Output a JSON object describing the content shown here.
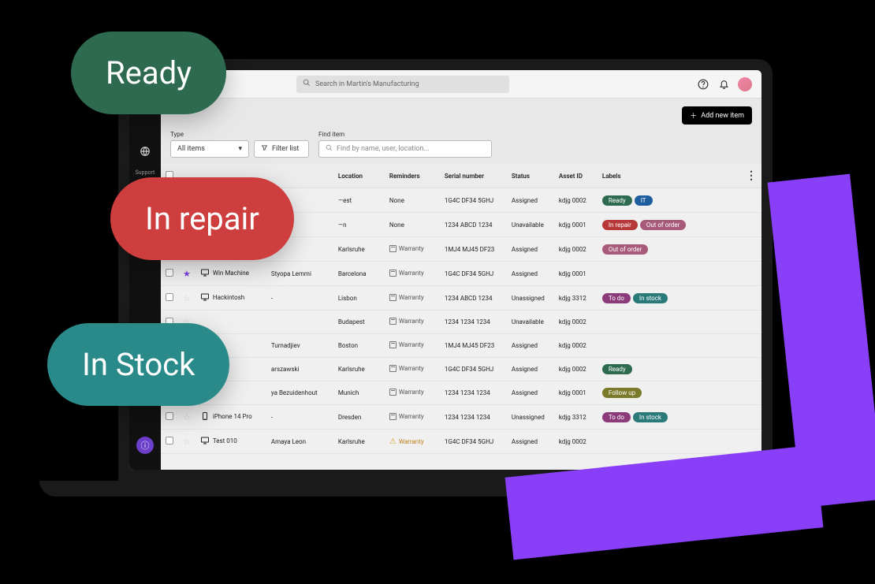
{
  "overlays": {
    "ready": "Ready",
    "in_repair": "In repair",
    "in_stock": "In Stock"
  },
  "sidebar": {
    "support_label": "Support"
  },
  "topbar": {
    "search_placeholder": "Search in Martin's Manufacturing"
  },
  "actions": {
    "add_item": "Add new item"
  },
  "filters": {
    "type_label": "Type",
    "type_value": "All items",
    "filter_list": "Filter list",
    "find_label": "Find item",
    "find_placeholder": "Find by name, user, location..."
  },
  "columns": {
    "location": "Location",
    "reminders": "Reminders",
    "serial": "Serial number",
    "status": "Status",
    "asset_id": "Asset ID",
    "labels": "Labels"
  },
  "rows": [
    {
      "favorite": false,
      "device_type": "desktop",
      "device": "—",
      "user": "—",
      "location": "—est",
      "reminder": "None",
      "reminder_kind": "none",
      "serial": "1G4C DF34 5GHJ",
      "status": "Assigned",
      "asset_id": "kdjg 0002",
      "labels": [
        "Ready",
        "IT"
      ]
    },
    {
      "favorite": false,
      "device_type": "laptop",
      "device": "—",
      "user": "—",
      "location": "—n",
      "reminder": "None",
      "reminder_kind": "none",
      "serial": "1234 ABCD 1234",
      "status": "Unavailable",
      "asset_id": "kdjg 0001",
      "labels": [
        "In repair",
        "Out of order"
      ]
    },
    {
      "favorite": false,
      "device_type": "desktop",
      "device": "—",
      "user": "—",
      "location": "Karlsruhe",
      "reminder": "Warranty",
      "reminder_kind": "cal",
      "serial": "1MJ4 MJ45 DF23",
      "status": "Assigned",
      "asset_id": "kdjg 0002",
      "labels": [
        "Out of order"
      ]
    },
    {
      "favorite": true,
      "device_type": "desktop",
      "device": "Win Machine",
      "user": "Styopa Lemmi",
      "location": "Barcelona",
      "reminder": "Warranty",
      "reminder_kind": "cal",
      "serial": "1G4C DF34 5GHJ",
      "status": "Assigned",
      "asset_id": "kdjg 0001",
      "labels": []
    },
    {
      "favorite": false,
      "device_type": "desktop",
      "device": "Hackintosh",
      "user": "-",
      "location": "Lisbon",
      "reminder": "Warranty",
      "reminder_kind": "cal",
      "serial": "1234 ABCD 1234",
      "status": "Unassigned",
      "asset_id": "kdjg 3312",
      "labels": [
        "To do",
        "In stock"
      ]
    },
    {
      "favorite": false,
      "device_type": "",
      "device": "",
      "user": "",
      "location": "Budapest",
      "reminder": "Warranty",
      "reminder_kind": "cal",
      "serial": "1234 1234 1234",
      "status": "Unavailable",
      "asset_id": "kdjg 0002",
      "labels": []
    },
    {
      "favorite": false,
      "device_type": "",
      "device": "",
      "user": "Turnadjiev",
      "location": "Boston",
      "reminder": "Warranty",
      "reminder_kind": "cal",
      "serial": "1MJ4 MJ45 DF23",
      "status": "Assigned",
      "asset_id": "kdjg 0002",
      "labels": []
    },
    {
      "favorite": false,
      "device_type": "",
      "device": "",
      "user": "arszawski",
      "location": "Karlsruhe",
      "reminder": "Warranty",
      "reminder_kind": "cal",
      "serial": "1G4C DF34 5GHJ",
      "status": "Assigned",
      "asset_id": "kdjg 0002",
      "labels": [
        "Ready"
      ]
    },
    {
      "favorite": false,
      "device_type": "",
      "device": "",
      "user": "ya Bezuidenhout",
      "location": "Munich",
      "reminder": "Warranty",
      "reminder_kind": "cal",
      "serial": "1234 1234 1234",
      "status": "Assigned",
      "asset_id": "kdjg 0001",
      "labels": [
        "Follow up"
      ]
    },
    {
      "favorite": false,
      "device_type": "phone",
      "device": "iPhone 14 Pro",
      "user": "-",
      "location": "Dresden",
      "reminder": "Warranty",
      "reminder_kind": "cal",
      "serial": "1234 1234 1234",
      "status": "Unassigned",
      "asset_id": "kdjg 3312",
      "labels": [
        "To do",
        "In stock"
      ]
    },
    {
      "favorite": false,
      "device_type": "desktop",
      "device": "Test 010",
      "user": "Amaya Leon",
      "location": "Karlsruhe",
      "reminder": "Warranty",
      "reminder_kind": "warn",
      "serial": "1G4C DF34 5GHJ",
      "status": "Assigned",
      "asset_id": "kdjg 0002",
      "labels": []
    }
  ],
  "label_styles": {
    "Ready": "ready",
    "IT": "it",
    "In repair": "inrepair",
    "Out of order": "outorder",
    "To do": "todo",
    "In stock": "instock",
    "Follow up": "followup"
  }
}
